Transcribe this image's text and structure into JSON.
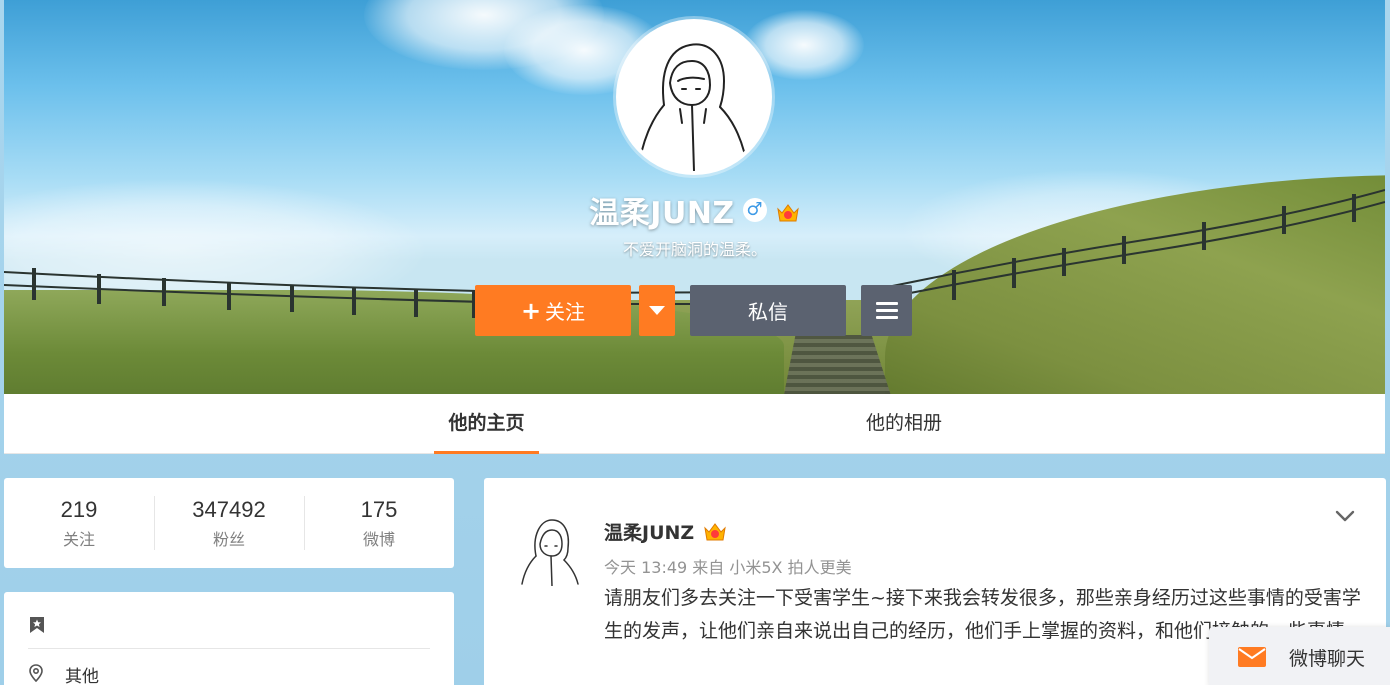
{
  "profile": {
    "name": "温柔JUNZ",
    "gender_icon": "male-icon",
    "gender_glyph": "♂",
    "vip_icon": "vip-crown-icon",
    "bio": "不爱开脑洞的温柔。"
  },
  "actions": {
    "follow_label": "关注",
    "follow_plus": "+",
    "message_label": "私信",
    "menu_icon": "hamburger-menu-icon",
    "dropdown_icon": "caret-down-icon"
  },
  "tabs": [
    {
      "label": "他的主页",
      "active": true
    },
    {
      "label": "他的相册",
      "active": false
    }
  ],
  "stats": [
    {
      "value": "219",
      "label": "关注"
    },
    {
      "value": "347492",
      "label": "粉丝"
    },
    {
      "value": "175",
      "label": "微博"
    }
  ],
  "info": {
    "bookmark_icon": "bookmark-star-icon",
    "location_icon": "location-pin-icon",
    "location": "其他"
  },
  "post": {
    "author": "温柔JUNZ",
    "meta": "今天 13:49 来自 小米5X 拍人更美",
    "text": "请朋友们多去关注一下受害学生~接下来我会转发很多，那些亲身经历过这些事情的受害学生的发声，让他们亲自来说出自己的经历，他们手上掌握的资料，和他们接触的一些事情。",
    "expand_icon": "chevron-down-icon"
  },
  "chat": {
    "label": "微博聊天",
    "icon": "mail-icon"
  },
  "colors": {
    "accent": "#ff7b22",
    "secondary_button": "#5b6270",
    "page_bg": "#a9d6ee"
  }
}
